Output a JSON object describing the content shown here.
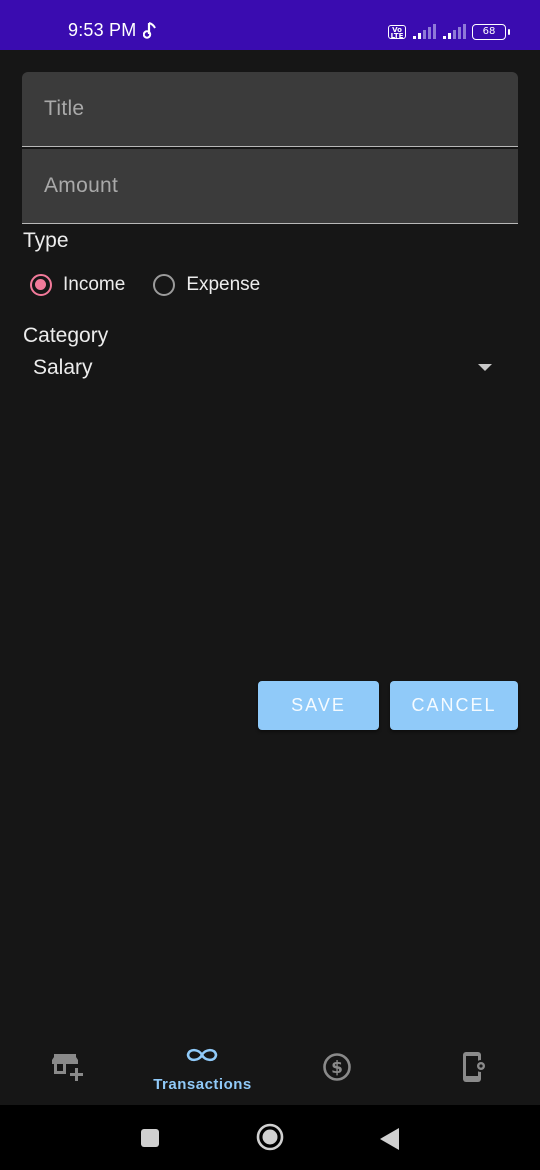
{
  "status_bar": {
    "time": "9:53 PM",
    "volte_label": "Vo LTE",
    "battery": "68",
    "background_color": "#3a0cb0"
  },
  "form": {
    "title_placeholder": "Title",
    "amount_placeholder": "Amount",
    "type_label": "Type",
    "type_options": [
      {
        "label": "Income",
        "selected": true
      },
      {
        "label": "Expense",
        "selected": false
      }
    ],
    "category_label": "Category",
    "category_value": "Salary",
    "radio_accent_color": "#f27a9a"
  },
  "buttons": {
    "save": "SAVE",
    "cancel": "CANCEL",
    "color": "#90caf9"
  },
  "bottom_nav": {
    "items": [
      {
        "icon": "add-store-icon",
        "label": "",
        "active": false
      },
      {
        "icon": "infinity-icon",
        "label": "Transactions",
        "active": true
      },
      {
        "icon": "dollar-circle-icon",
        "label": "",
        "active": false
      },
      {
        "icon": "phone-settings-icon",
        "label": "",
        "active": false
      }
    ],
    "active_color": "#90caf9"
  },
  "system_nav": {
    "buttons": [
      "recents-icon",
      "home-icon",
      "back-icon"
    ]
  }
}
